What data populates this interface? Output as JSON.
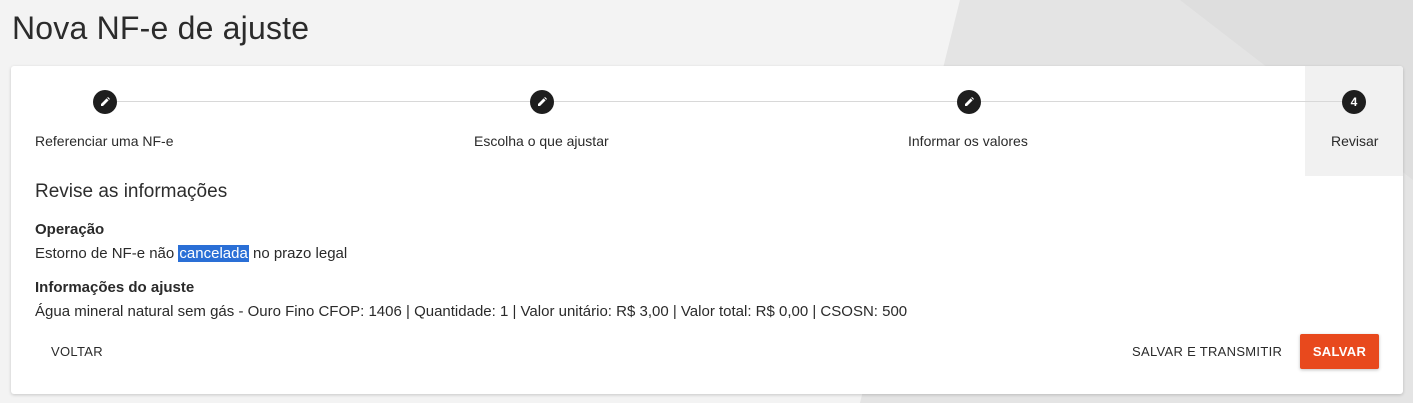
{
  "page": {
    "title": "Nova NF-e de ajuste"
  },
  "stepper": {
    "steps": [
      {
        "number": "",
        "label": "Referenciar uma NF-e",
        "state": "completed",
        "icon": "pencil-icon"
      },
      {
        "number": "",
        "label": "Escolha o que ajustar",
        "state": "completed",
        "icon": "pencil-icon"
      },
      {
        "number": "",
        "label": "Informar os valores",
        "state": "completed",
        "icon": "pencil-icon"
      },
      {
        "number": "4",
        "label": "Revisar",
        "state": "active",
        "icon": ""
      }
    ]
  },
  "review": {
    "title": "Revise as informações",
    "operation": {
      "label": "Operação",
      "value_before": "Estorno de NF-e não ",
      "value_highlighted": "cancelada",
      "value_after": " no prazo legal"
    },
    "adjustment": {
      "label": "Informações do ajuste",
      "value": "Água mineral natural sem gás - Ouro Fino CFOP: 1406 | Quantidade: 1 | Valor unitário: R$ 3,00 | Valor total: R$ 0,00 | CSOSN: 500"
    }
  },
  "actions": {
    "back_label": "VOLTAR",
    "save_transmit_label": "SALVAR E TRANSMITIR",
    "save_label": "SALVAR"
  },
  "colors": {
    "primary": "#e8491d",
    "step_circle": "#1e1e1e",
    "selection": "#2a6fd6"
  }
}
